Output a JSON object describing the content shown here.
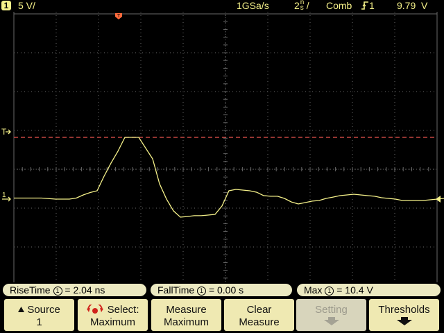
{
  "header": {
    "channel_badge": "1",
    "volts_per_div": "5 V/",
    "sample_rate": "1GSa/s",
    "time_per_div_num": "2",
    "time_per_div_unit_top": "n",
    "time_per_div_unit_bottom": "s",
    "acq_mode": "Comb",
    "trigger_source": "1",
    "trigger_level": "9.79",
    "trigger_level_unit": "V"
  },
  "screen": {
    "trigger_marker": "T",
    "ground_marker": "1"
  },
  "measurements": [
    {
      "label": "RiseTime",
      "source": "1",
      "value": "= 2.04 ns"
    },
    {
      "label": "FallTime",
      "source": "1",
      "value": "= 0.00 s"
    },
    {
      "label": "Max",
      "source": "1",
      "value": "= 10.4 V"
    }
  ],
  "softkeys": [
    {
      "line1": "Source",
      "line2": "1"
    },
    {
      "line1": "Select:",
      "line2": "Maximum"
    },
    {
      "line1": "Measure",
      "line2": "Maximum"
    },
    {
      "line1": "Clear",
      "line2": "Measure"
    },
    {
      "line1": "Setting",
      "line2": ""
    },
    {
      "line1": "Thresholds",
      "line2": ""
    }
  ],
  "colors": {
    "trace": "#f6f28a",
    "threshold_line": "#e0504a",
    "graticule": "#6a6a6a",
    "trigger_marker": "#ff6a3c",
    "softkey_bg": "#efe9b2"
  },
  "icons": [
    "channel-badge-icon",
    "rising-edge-icon",
    "trigger-marker-icon",
    "level-marker-icon",
    "ground-marker-icon",
    "up-arrow-icon",
    "select-knob-icon",
    "down-arrow-icon"
  ],
  "chart_data": {
    "type": "line",
    "trace_grid": {
      "x": [
        0,
        40,
        60,
        80,
        90,
        100,
        110,
        120,
        130,
        140,
        150,
        160,
        180,
        200,
        210,
        220,
        230,
        240,
        250,
        260,
        270,
        280,
        290,
        300,
        310,
        320,
        330,
        340,
        350,
        360,
        370,
        380,
        390,
        400,
        410,
        420,
        430,
        440,
        450,
        460,
        470,
        480,
        490,
        500,
        510,
        520,
        530,
        540,
        550,
        560,
        570,
        580,
        590,
        600,
        610,
        620,
        630
      ],
      "y": [
        0.11,
        0.11,
        0.0,
        0.0,
        0.11,
        0.43,
        0.68,
        0.86,
        2.36,
        3.71,
        4.93,
        6.36,
        6.36,
        4.14,
        1.57,
        0.0,
        -1.21,
        -1.86,
        -1.79,
        -1.71,
        -1.71,
        -1.64,
        -1.57,
        -0.71,
        0.86,
        1.0,
        0.93,
        0.86,
        0.71,
        0.36,
        0.29,
        0.29,
        0.07,
        -0.29,
        -0.5,
        -0.36,
        -0.21,
        -0.14,
        0.07,
        0.21,
        0.36,
        0.43,
        0.5,
        0.43,
        0.36,
        0.29,
        0.14,
        0.07,
        0.0,
        -0.14,
        -0.14,
        -0.14,
        -0.14,
        -0.07,
        0.0,
        0.07,
        0.14
      ]
    },
    "threshold_grid_level": 6.36,
    "grid": true
  }
}
